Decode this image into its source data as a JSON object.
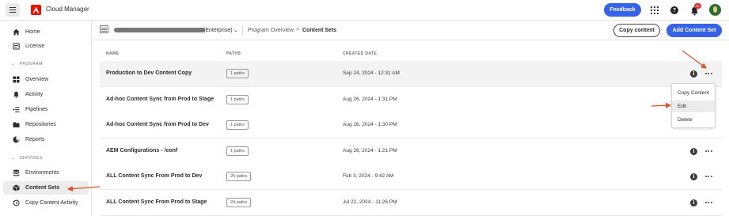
{
  "header": {
    "app_title": "Cloud Manager",
    "feedback_label": "Feedback",
    "help_glyph": "?",
    "notification_count": "9+"
  },
  "sidebar": {
    "items_top": [
      {
        "label": "Home",
        "icon": "home-icon"
      },
      {
        "label": "License",
        "icon": "license-icon"
      }
    ],
    "program_section": "PROGRAM",
    "items_program": [
      {
        "label": "Overview",
        "icon": "overview-icon"
      },
      {
        "label": "Activity",
        "icon": "activity-icon"
      },
      {
        "label": "Pipelines",
        "icon": "pipelines-icon"
      },
      {
        "label": "Repositories",
        "icon": "repositories-icon"
      },
      {
        "label": "Reports",
        "icon": "reports-icon"
      }
    ],
    "services_section": "SERVICES",
    "items_services": [
      {
        "label": "Environments",
        "icon": "environments-icon"
      },
      {
        "label": "Content Sets",
        "icon": "content-sets-icon",
        "selected": true
      },
      {
        "label": "Copy Content Activity",
        "icon": "history-icon"
      }
    ]
  },
  "content_header": {
    "program_suffix": "(Enterprise)",
    "breadcrumb_program_overview": "Program Overview",
    "breadcrumb_separator": ">",
    "breadcrumb_current": "Content Sets",
    "copy_content_label": "Copy content",
    "add_content_set_label": "Add Content Set"
  },
  "table": {
    "columns": {
      "name": "NAME",
      "paths": "PATHS",
      "created_date": "CREATED DATE"
    },
    "rows": [
      {
        "name": "Production to Dev Content Copy",
        "paths": "1 paths",
        "date": "Sep 24, 2024 - 12:31 AM"
      },
      {
        "name": "Ad-hoc Content Sync from Prod to Stage",
        "paths": "1 paths",
        "date": "Aug 26, 2024 - 1:31 PM"
      },
      {
        "name": "Ad-hoc Content Sync from Prod to Dev",
        "paths": "1 paths",
        "date": "Aug 26, 2024 - 1:30 PM"
      },
      {
        "name": "AEM Configurations - /conf",
        "paths": "1 paths",
        "date": "Aug 26, 2024 - 1:21 PM"
      },
      {
        "name": "ALL Content Sync From Prod to Dev",
        "paths": "25 paths",
        "date": "Feb 3, 2024 - 9:42 AM"
      },
      {
        "name": "ALL Content Sync From Prod to Stage",
        "paths": "24 paths",
        "date": "Jul 22, 2024 - 11:26 PM"
      }
    ],
    "info_glyph": "i"
  },
  "menu": {
    "items": [
      "Copy Content",
      "Edit",
      "Delete"
    ]
  },
  "colors": {
    "accent": "#3562e8",
    "annotation_arrow": "#e0502b",
    "logo": "#eb1000"
  }
}
